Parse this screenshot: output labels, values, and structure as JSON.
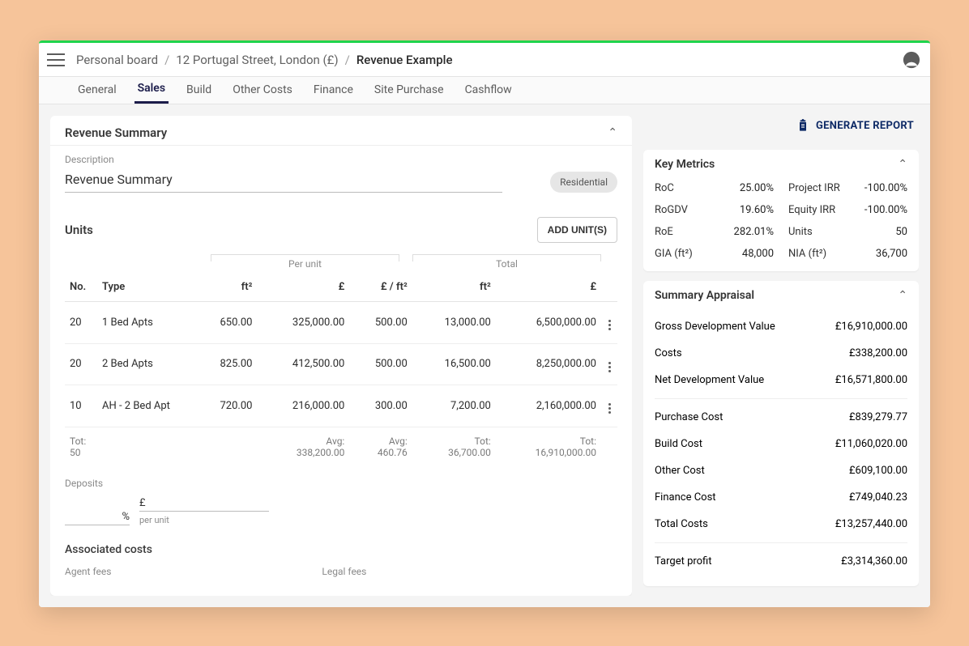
{
  "breadcrumbs": {
    "board": "Personal board",
    "project": "12 Portugal Street, London (£)",
    "page": "Revenue Example"
  },
  "tabs": [
    "General",
    "Sales",
    "Build",
    "Other Costs",
    "Finance",
    "Site Purchase",
    "Cashflow"
  ],
  "active_tab": "Sales",
  "revenue": {
    "section_title": "Revenue Summary",
    "description_label": "Description",
    "description_value": "Revenue Summary",
    "chip": "Residential"
  },
  "units": {
    "title": "Units",
    "add_button": "ADD UNIT(S)",
    "group_per_unit": "Per unit",
    "group_total": "Total",
    "headers": {
      "no": "No.",
      "type": "Type",
      "ft2": "ft²",
      "gbp": "£",
      "gbp_ft2": "£ / ft²",
      "tot_ft2": "ft²",
      "tot_gbp": "£"
    },
    "rows": [
      {
        "no": "20",
        "type": "1 Bed Apts",
        "ft2": "650.00",
        "gbp": "325,000.00",
        "gbp_ft2": "500.00",
        "tot_ft2": "13,000.00",
        "tot_gbp": "6,500,000.00"
      },
      {
        "no": "20",
        "type": "2 Bed Apts",
        "ft2": "825.00",
        "gbp": "412,500.00",
        "gbp_ft2": "500.00",
        "tot_ft2": "16,500.00",
        "tot_gbp": "8,250,000.00"
      },
      {
        "no": "10",
        "type": "AH - 2 Bed Apt",
        "ft2": "720.00",
        "gbp": "216,000.00",
        "gbp_ft2": "300.00",
        "tot_ft2": "7,200.00",
        "tot_gbp": "2,160,000.00"
      }
    ],
    "totals": {
      "no_label": "Tot:",
      "no_value": "50",
      "gbp_label": "Avg:",
      "gbp_value": "338,200.00",
      "gbp_ft2_label": "Avg:",
      "gbp_ft2_value": "460.76",
      "tot_ft2_label": "Tot:",
      "tot_ft2_value": "36,700.00",
      "tot_gbp_label": "Tot:",
      "tot_gbp_value": "16,910,000.00"
    }
  },
  "deposits": {
    "label": "Deposits",
    "pct_suffix": "%",
    "gbp_suffix": "£",
    "per_unit": "per unit"
  },
  "associated": {
    "title": "Associated costs",
    "agent": "Agent fees",
    "legal": "Legal fees"
  },
  "actions": {
    "generate_report": "GENERATE REPORT"
  },
  "key_metrics": {
    "title": "Key Metrics",
    "left": [
      {
        "k": "RoC",
        "v": "25.00%"
      },
      {
        "k": "RoGDV",
        "v": "19.60%"
      },
      {
        "k": "RoE",
        "v": "282.01%"
      },
      {
        "k": "GIA (ft²)",
        "v": "48,000"
      }
    ],
    "right": [
      {
        "k": "Project IRR",
        "v": "-100.00%"
      },
      {
        "k": "Equity IRR",
        "v": "-100.00%"
      },
      {
        "k": "Units",
        "v": "50"
      },
      {
        "k": "NIA (ft²)",
        "v": "36,700"
      }
    ]
  },
  "summary_appraisal": {
    "title": "Summary Appraisal",
    "block1": [
      {
        "k": "Gross Development Value",
        "v": "£16,910,000.00"
      },
      {
        "k": "Costs",
        "v": "£338,200.00"
      },
      {
        "k": "Net Development Value",
        "v": "£16,571,800.00"
      }
    ],
    "block2": [
      {
        "k": "Purchase Cost",
        "v": "£839,279.77"
      },
      {
        "k": "Build Cost",
        "v": "£11,060,020.00"
      },
      {
        "k": "Other Cost",
        "v": "£609,100.00"
      },
      {
        "k": "Finance Cost",
        "v": "£749,040.23"
      },
      {
        "k": "Total Costs",
        "v": "£13,257,440.00"
      }
    ],
    "block3": [
      {
        "k": "Target profit",
        "v": "£3,314,360.00"
      }
    ]
  }
}
